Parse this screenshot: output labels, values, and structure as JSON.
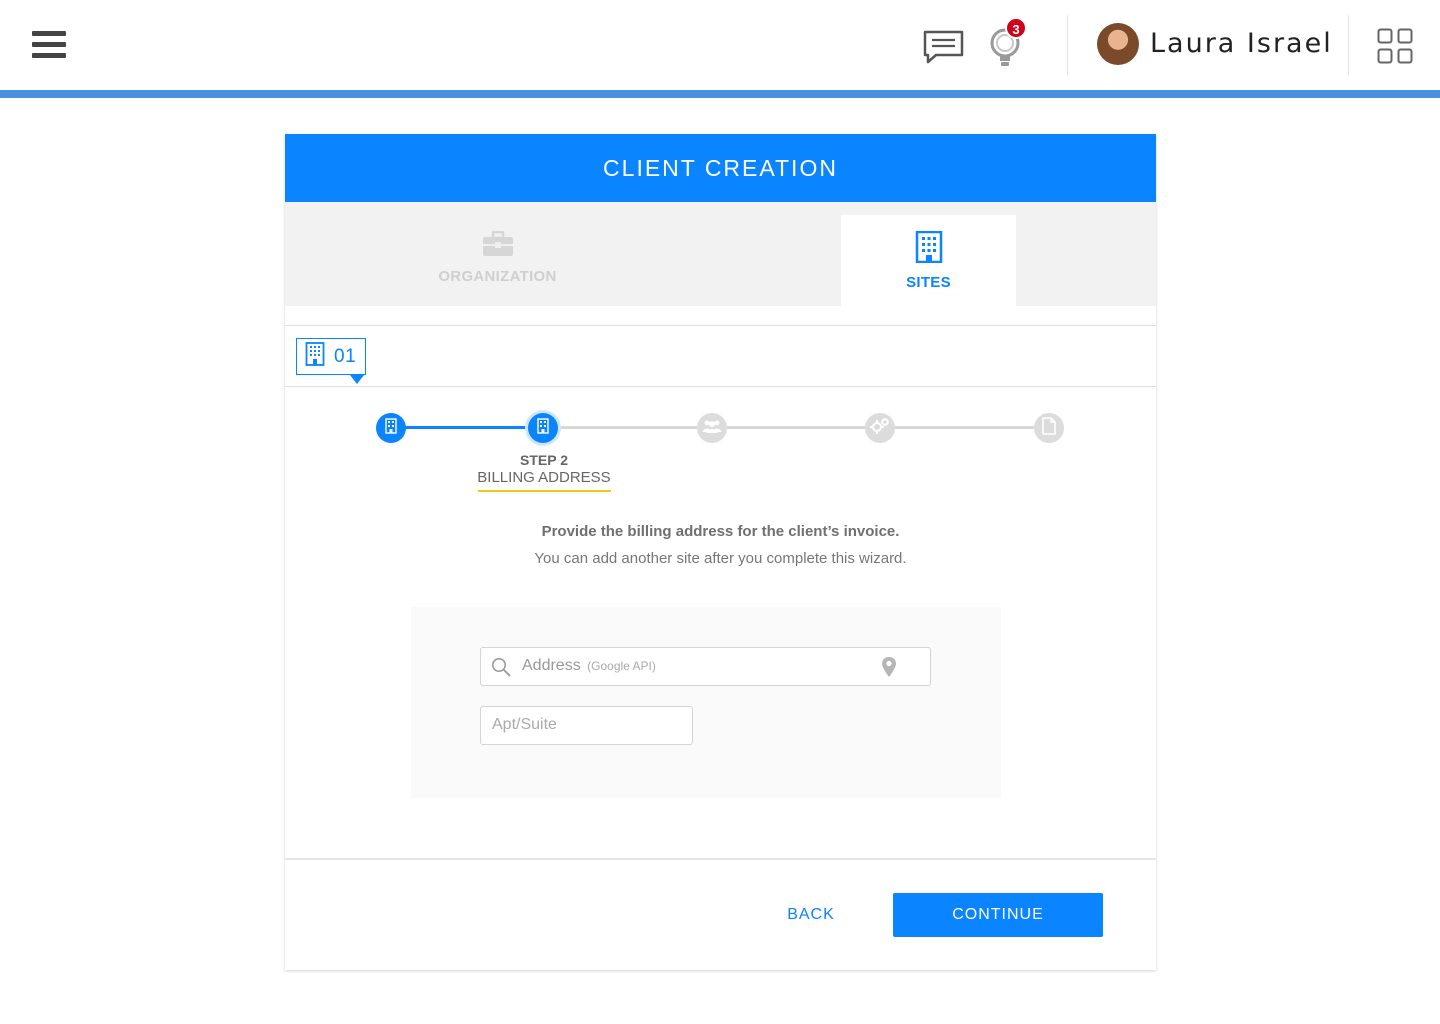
{
  "header": {
    "user_name": "Laura Israel",
    "notification_count": "3",
    "accent_color": "#4a90e2",
    "icons": [
      "hamburger-menu-icon",
      "chat-icon",
      "lightbulb-icon",
      "avatar",
      "apps-grid-icon"
    ]
  },
  "card": {
    "title": "CLIENT CREATION",
    "tabs": [
      {
        "label": "ORGANIZATION",
        "icon": "briefcase-icon",
        "active": false
      },
      {
        "label": "SITES",
        "icon": "building-icon",
        "active": true
      }
    ],
    "site_badge": "01",
    "stepper": {
      "current_step_number": "STEP 2",
      "current_step_name": "BILLING ADDRESS",
      "steps": [
        {
          "icon": "building-icon",
          "state": "done"
        },
        {
          "icon": "building-icon",
          "state": "current"
        },
        {
          "icon": "people-icon",
          "state": "pending"
        },
        {
          "icon": "gears-icon",
          "state": "pending"
        },
        {
          "icon": "document-icon",
          "state": "pending"
        }
      ]
    },
    "intro_title": "Provide the billing address for the client’s invoice.",
    "intro_sub": "You can add another site after you complete this wizard.",
    "address": {
      "placeholder": "Address",
      "hint": "(Google API)",
      "value": ""
    },
    "apt": {
      "placeholder": "Apt/Suite",
      "value": ""
    },
    "back_label": "BACK",
    "continue_label": "CONTINUE",
    "primary_color": "#0a84ff",
    "highlight_color": "#f5c518"
  }
}
